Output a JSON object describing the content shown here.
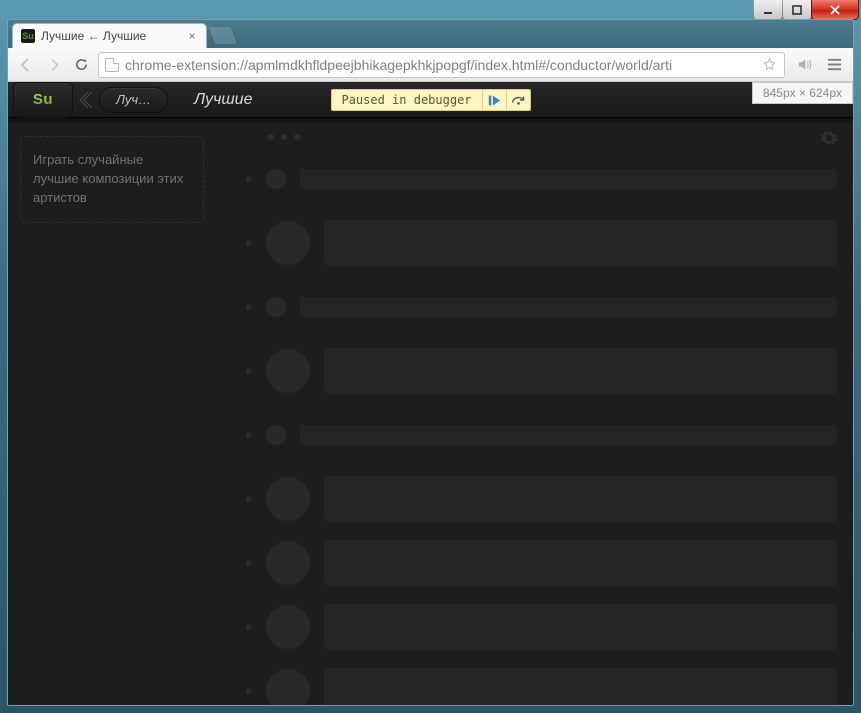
{
  "window": {
    "tab_title": "Лучшие ← Лучшие",
    "url": "chrome-extension://apmlmdkhfldpeejbhikagepkhkjpopgf/index.html#/conductor/world/arti",
    "ruler": "845px × 624px"
  },
  "app": {
    "brand": "Su",
    "crumb_pill": "Луч…",
    "crumb_title": "Лучшие",
    "promo": "Играть случайные лучшие композиции этих артистов"
  },
  "debugger": {
    "label": "Paused in debugger"
  }
}
